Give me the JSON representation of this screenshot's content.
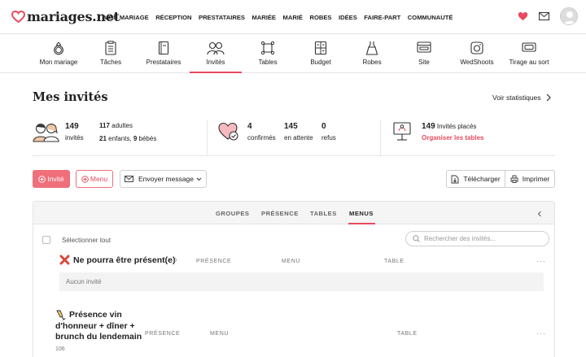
{
  "brand": {
    "name": "mariages.net"
  },
  "topnav": [
    "MON MARIAGE",
    "RÉCEPTION",
    "PRESTATAIRES",
    "MARIÉE",
    "MARIÉ",
    "ROBES",
    "IDÉES",
    "FAIRE-PART",
    "COMMUNAUTÉ"
  ],
  "subnav": [
    {
      "label": "Mon mariage",
      "icon": "rings-icon"
    },
    {
      "label": "Tâches",
      "icon": "checklist-icon"
    },
    {
      "label": "Prestataires",
      "icon": "book-icon"
    },
    {
      "label": "Invités",
      "icon": "guests-icon",
      "active": true
    },
    {
      "label": "Tables",
      "icon": "table-icon"
    },
    {
      "label": "Budget",
      "icon": "calculator-icon"
    },
    {
      "label": "Robes",
      "icon": "dress-icon"
    },
    {
      "label": "Site",
      "icon": "website-icon"
    },
    {
      "label": "WedShoots",
      "icon": "camera-icon"
    },
    {
      "label": "Tirage au sort",
      "icon": "ticket-icon"
    }
  ],
  "page": {
    "title": "Mes invités",
    "stats_link": "Voir statistiques"
  },
  "summary": {
    "guests_total": "149",
    "guests_label": "invités",
    "adults_count": "117",
    "adults_label": "adultes",
    "children_count": "21",
    "children_label": "enfants,",
    "babies_count": "9",
    "babies_label": "bébés",
    "confirmed_count": "4",
    "confirmed_label": "confirmés",
    "pending_count": "145",
    "pending_label": "en attente",
    "declined_count": "0",
    "declined_label": "refus",
    "seated_count": "149",
    "seated_label": "Invités placés",
    "organize_link": "Organiser les tables"
  },
  "actions": {
    "add_guest": "Invité",
    "add_menu": "Menu",
    "send_message": "Envoyer message",
    "download": "Télécharger",
    "print": "Imprimer"
  },
  "tabs": [
    "GROUPES",
    "PRÉSENCE",
    "TABLES",
    "MENUS"
  ],
  "list": {
    "select_all": "Sélectionner tout",
    "search_placeholder": "Rechercher des invités...",
    "groups": [
      {
        "title": "Ne pourra être présent(e)",
        "count": "0",
        "columns": [
          "PRÉSENCE",
          "MENU",
          "TABLE"
        ],
        "empty_text": "Aucun invité"
      },
      {
        "title": "Présence vin d'honneur + dîner + brunch du lendemain",
        "title_lines": [
          "Présence vin",
          "d'honneur + dîner +",
          "brunch du lendemain"
        ],
        "count": "106",
        "columns": [
          "PRÉSENCE",
          "MENU",
          "TABLE"
        ]
      }
    ]
  },
  "colors": {
    "accent": "#e84a5f",
    "button": "#ef6f7a"
  }
}
